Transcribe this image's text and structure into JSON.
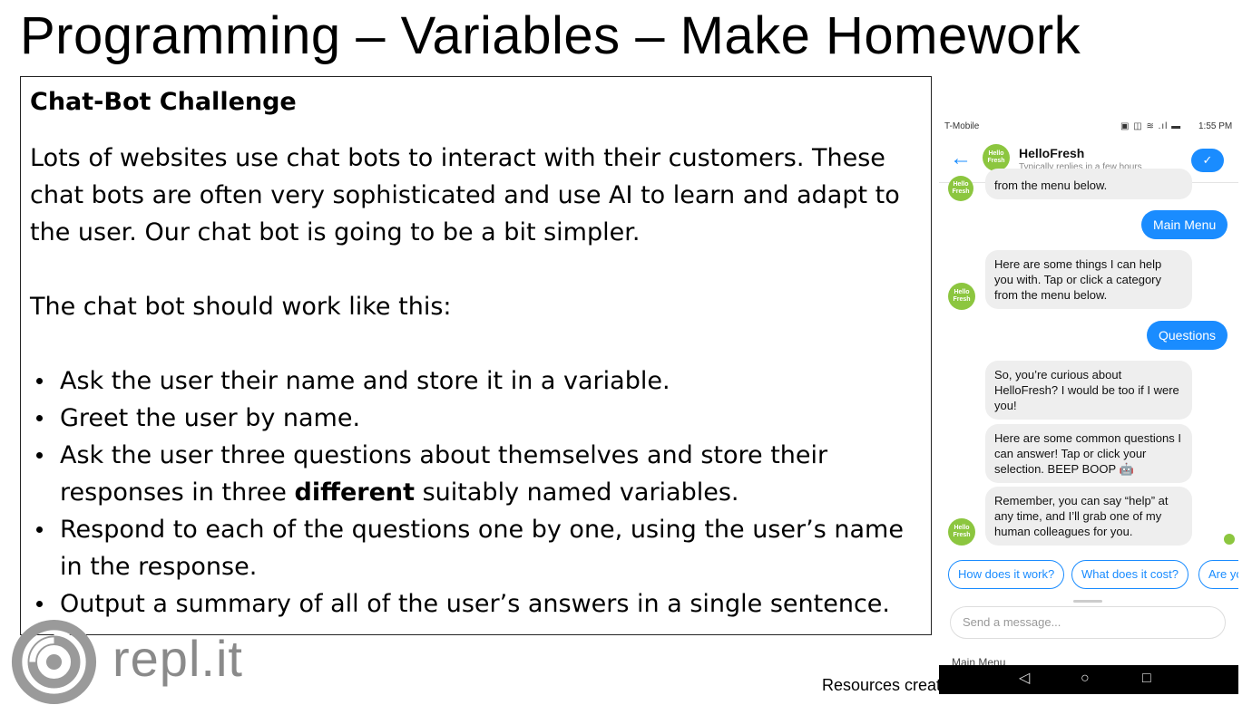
{
  "slide": {
    "title": "Programming – Variables – Make Homework",
    "heading": "Chat-Bot Challenge",
    "paragraph1": "Lots of websites use chat bots to interact with their customers.  These chat bots are often very sophisticated and use AI to learn and adapt to the user.  Our chat bot is going to be a bit simpler.",
    "paragraph2": "The chat bot should work like this:",
    "bullets": [
      "Ask the user their name and store it in a variable.",
      "Greet the user by name.",
      {
        "before": "Ask the user three questions about themselves and store their responses in three ",
        "bold": "different",
        "after": " suitably named variables."
      },
      "Respond to each of the questions one by one, using the user’s name in the response.",
      "Output a summary of all of the user’s answers in a single sentence."
    ],
    "footer": "Resources created by Jay Harvey (@Mr_Harvey)"
  },
  "logo": {
    "text": "repl.it",
    "color": "#8a8a8a"
  },
  "phone": {
    "carrier": "T-Mobile",
    "time": "1:55 PM",
    "contact_name": "HelloFresh",
    "contact_status": "Typically replies in a few hours",
    "avatar_text": "Hello Fresh",
    "partial_message": "from the menu below.",
    "user_msg1": "Main Menu",
    "bot_msg1": "Here are some things I can help you with. Tap or click a category from the menu below.",
    "user_msg2": "Questions",
    "bot_msg2": "So, you’re curious about HelloFresh? I would be too if I were you!",
    "bot_msg3": "Here are some common questions I can answer! Tap or click your selection. BEEP BOOP 🤖",
    "bot_msg4": "Remember, you can say “help” at any time, and I’ll grab one of my human colleagues for you.",
    "quick_replies": [
      "How does it work?",
      "What does it cost?",
      "Are yo"
    ],
    "input_placeholder": "Send a message...",
    "peek_text": "Main Menu",
    "colors": {
      "accent": "#1a8cff",
      "brand_green": "#8cc63f",
      "bubble_gray": "#eeeeee"
    }
  }
}
